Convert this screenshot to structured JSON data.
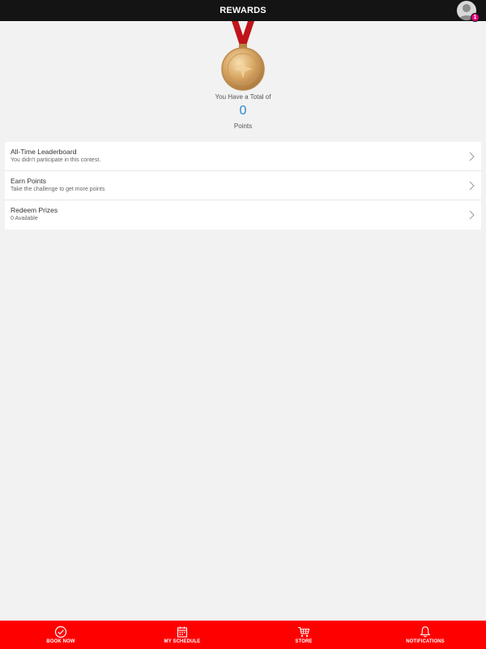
{
  "header": {
    "title": "REWARDS",
    "notification_count": "1"
  },
  "rewards": {
    "total_label": "You Have a Total of",
    "points": "0",
    "points_label": "Points"
  },
  "menu": {
    "items": [
      {
        "title": "All-Time Leaderboard",
        "subtitle": "You didn't participate in this contest."
      },
      {
        "title": "Earn Points",
        "subtitle": "Take the challenge to get more points"
      },
      {
        "title": "Redeem Prizes",
        "subtitle": "0 Available"
      }
    ]
  },
  "tabbar": {
    "tabs": [
      {
        "label": "BOOK NOW",
        "icon": "check-circle-icon"
      },
      {
        "label": "MY SCHEDULE",
        "icon": "calendar-icon"
      },
      {
        "label": "STORE",
        "icon": "cart-icon"
      },
      {
        "label": "NOTIFICATIONS",
        "icon": "bell-icon"
      }
    ]
  },
  "colors": {
    "topbar": "#141414",
    "accent_blue": "#2a86d1",
    "tabbar": "#ff0000",
    "badge": "#e6007e"
  }
}
